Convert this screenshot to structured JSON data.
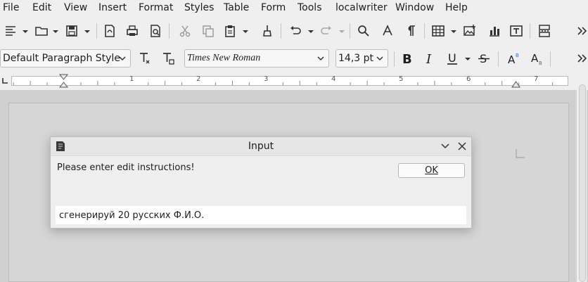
{
  "menubar": {
    "items": [
      "File",
      "Edit",
      "View",
      "Insert",
      "Format",
      "Styles",
      "Table",
      "Form",
      "Tools",
      "localwriter",
      "Window",
      "Help"
    ]
  },
  "toolbar": {
    "paragraph_style": "Default Paragraph Style",
    "font_name": "Times New Roman",
    "font_size": "14,3 pt",
    "icons": [
      "sidebar-icon",
      "open-icon",
      "save-icon",
      "export-pdf-icon",
      "print-icon",
      "print-preview-icon",
      "cut-icon",
      "copy-icon",
      "paste-icon",
      "clone-formatting-icon",
      "undo-icon",
      "redo-icon",
      "find-replace-icon",
      "spelling-icon",
      "formatting-marks-icon",
      "insert-table-icon",
      "insert-image-icon",
      "insert-chart-icon",
      "insert-textbox-icon",
      "page-break-icon",
      "more-icon"
    ],
    "format_icons": [
      "update-style-icon",
      "new-style-icon",
      "bold-icon",
      "italic-icon",
      "underline-icon",
      "strikethrough-icon",
      "superscript-icon",
      "subscript-icon",
      "more-icon"
    ]
  },
  "ruler": {
    "numbers": [
      "1",
      "2",
      "3",
      "4",
      "5",
      "6",
      "7"
    ]
  },
  "dialog": {
    "title": "Input",
    "message": "Please enter edit instructions!",
    "ok_label": "OK",
    "input_value": "сгенерируй 20 русских Ф.И.О."
  },
  "colors": {
    "chrome": "#efeff0",
    "document_bg": "#cfcfcf",
    "text": "#1e1e1e"
  }
}
